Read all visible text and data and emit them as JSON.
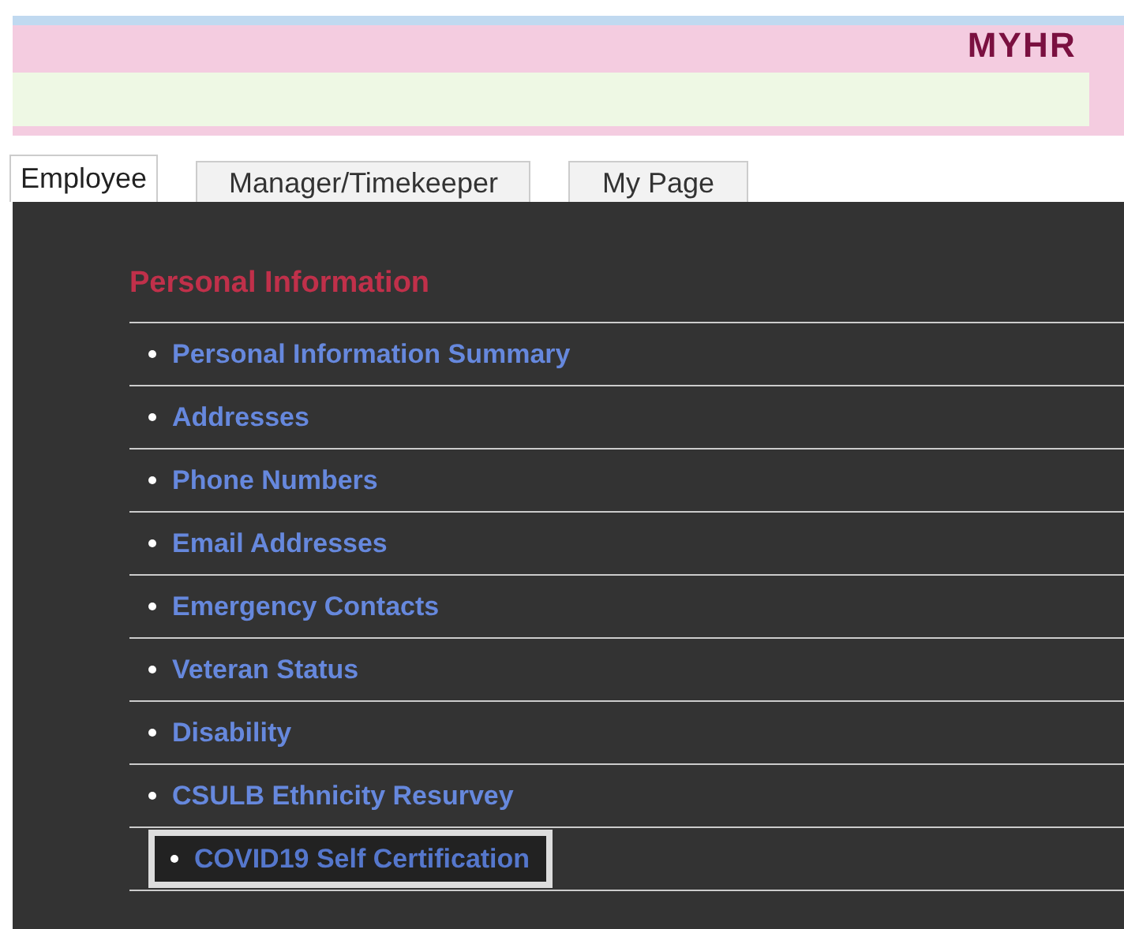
{
  "header": {
    "logo": "MYHR"
  },
  "tabs": [
    {
      "label": "Employee",
      "selected": true
    },
    {
      "label": "Manager/Timekeeper",
      "selected": false
    },
    {
      "label": "My Page",
      "selected": false
    }
  ],
  "section": {
    "title": "Personal Information",
    "items": [
      {
        "label": "Personal Information Summary",
        "selected": false
      },
      {
        "label": "Addresses",
        "selected": false
      },
      {
        "label": "Phone Numbers",
        "selected": false
      },
      {
        "label": "Email Addresses",
        "selected": false
      },
      {
        "label": "Emergency Contacts",
        "selected": false
      },
      {
        "label": "Veteran Status",
        "selected": false
      },
      {
        "label": "Disability",
        "selected": false
      },
      {
        "label": "CSULB Ethnicity Resurvey",
        "selected": false
      },
      {
        "label": "COVID19 Self Certification",
        "selected": true
      }
    ]
  }
}
